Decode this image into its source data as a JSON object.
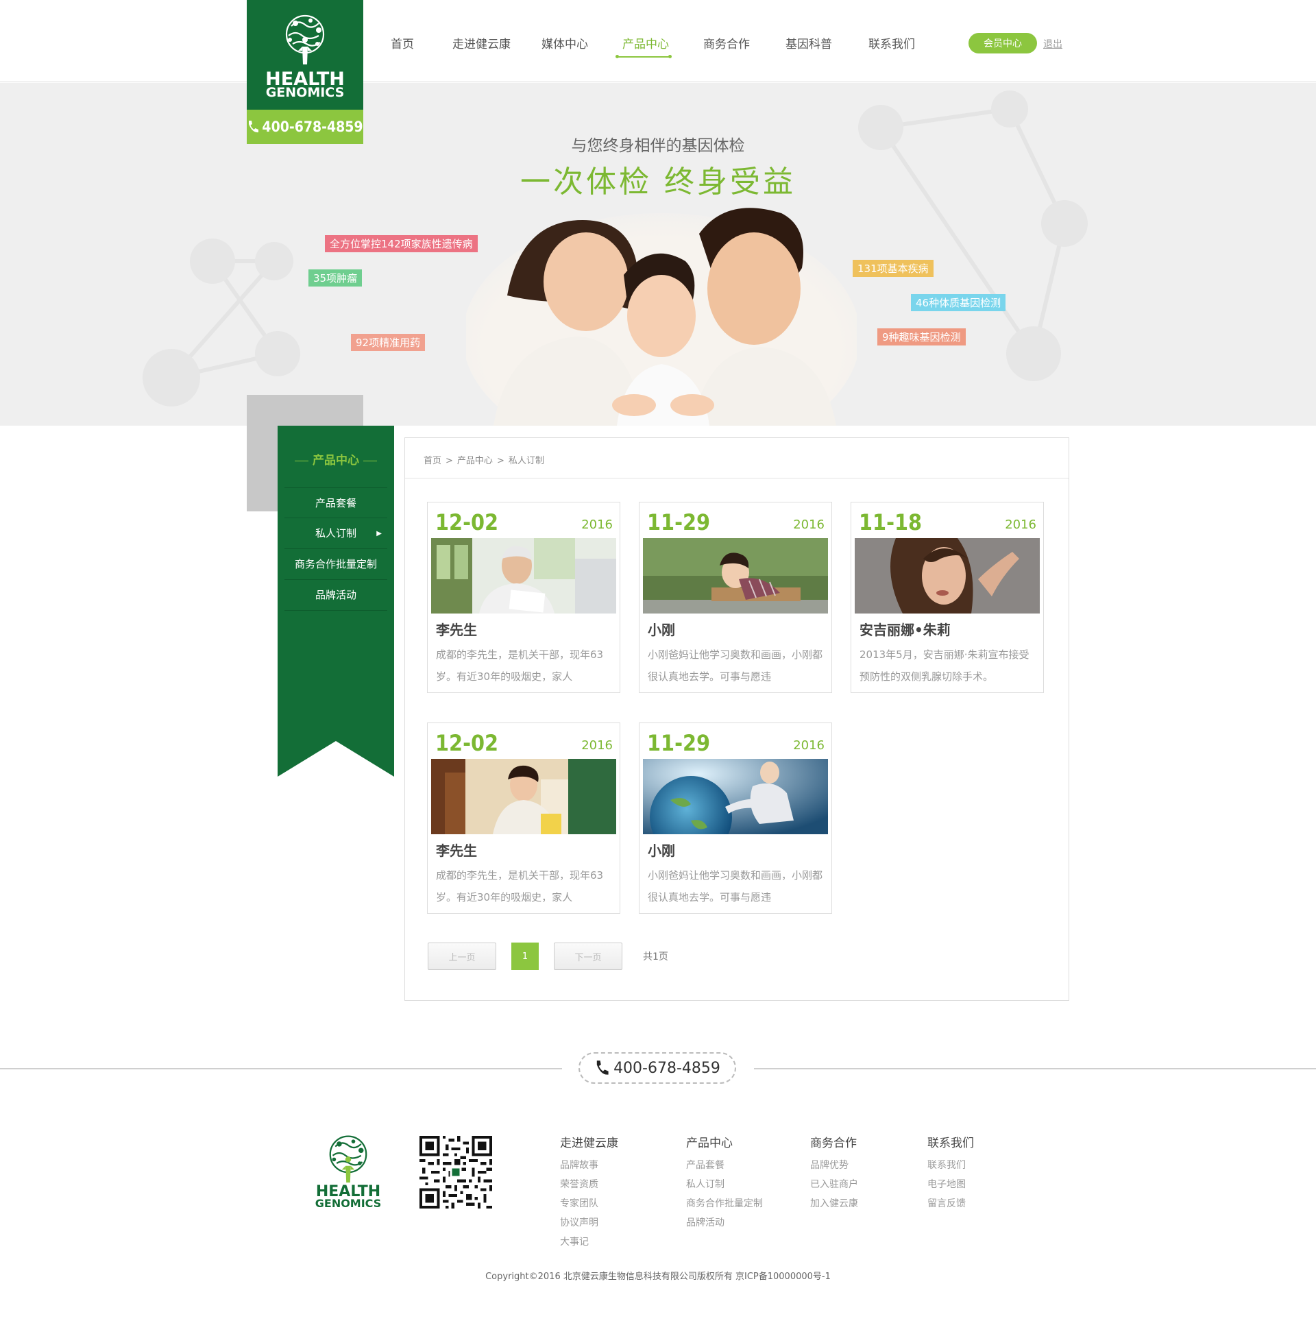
{
  "logo": {
    "line1": "HEALTH",
    "line2": "GENOMICS",
    "phone": "400-678-4859"
  },
  "nav": {
    "items": [
      "首页",
      "走进健云康",
      "媒体中心",
      "产品中心",
      "商务合作",
      "基因科普",
      "联系我们"
    ],
    "active_index": 3,
    "member": "会员中心",
    "logout": "退出"
  },
  "banner": {
    "subtitle": "与您终身相伴的基因体检",
    "title": "一次体检  终身受益",
    "tags": [
      {
        "text": "全方位掌控142项家族性遗传病",
        "color": "#ec7383"
      },
      {
        "text": "35项肿瘤",
        "color": "#6fce8f"
      },
      {
        "text": "92项精准用药",
        "color": "#f1a18f"
      },
      {
        "text": "131项基本疾病",
        "color": "#efc15c"
      },
      {
        "text": "46种体质基因检测",
        "color": "#79d5ec"
      },
      {
        "text": "9种趣味基因检测",
        "color": "#ef9a82"
      }
    ]
  },
  "sidebar": {
    "title": "产品中心",
    "items": [
      "产品套餐",
      "私人订制",
      "商务合作批量定制",
      "品牌活动"
    ]
  },
  "breadcrumb": [
    "首页",
    "产品中心",
    "私人订制"
  ],
  "breadcrumb_sep": ">",
  "cards": [
    {
      "date": "12-02",
      "year": "2016",
      "name": "李先生",
      "desc": "成都的李先生，是机关干部，现年63岁。有近30年的吸烟史，家人"
    },
    {
      "date": "11-29",
      "year": "2016",
      "name": "小刚",
      "desc": "小刚爸妈让他学习奥数和画画，小刚都很认真地去学。可事与愿违"
    },
    {
      "date": "11-18",
      "year": "2016",
      "name": "安吉丽娜•朱莉",
      "desc": "2013年5月，安吉丽娜·朱莉宣布接受预防性的双侧乳腺切除手术。"
    },
    {
      "date": "12-02",
      "year": "2016",
      "name": "李先生",
      "desc": "成都的李先生，是机关干部，现年63岁。有近30年的吸烟史，家人"
    },
    {
      "date": "11-29",
      "year": "2016",
      "name": "小刚",
      "desc": "小刚爸妈让他学习奥数和画画，小刚都很认真地去学。可事与愿违"
    }
  ],
  "pager": {
    "prev": "上一页",
    "current": "1",
    "next": "下一页",
    "total": "共1页"
  },
  "footer": {
    "phone": "400-678-4859",
    "columns": [
      {
        "title": "走进健云康",
        "links": [
          "品牌故事",
          "荣誉资质",
          "专家团队",
          "协议声明",
          "大事记"
        ]
      },
      {
        "title": "产品中心",
        "links": [
          "产品套餐",
          "私人订制",
          "商务合作批量定制",
          "品牌活动"
        ]
      },
      {
        "title": "商务合作",
        "links": [
          "品牌优势",
          "已入驻商户",
          "加入健云康"
        ]
      },
      {
        "title": "联系我们",
        "links": [
          "联系我们",
          "电子地图",
          "留言反馈"
        ]
      }
    ],
    "copyright": "Copyright©2016 北京健云康生物信息科技有限公司版权所有  京ICP备10000000号-1"
  },
  "colors": {
    "brand_green": "#136e37",
    "accent": "#8cc63f"
  }
}
